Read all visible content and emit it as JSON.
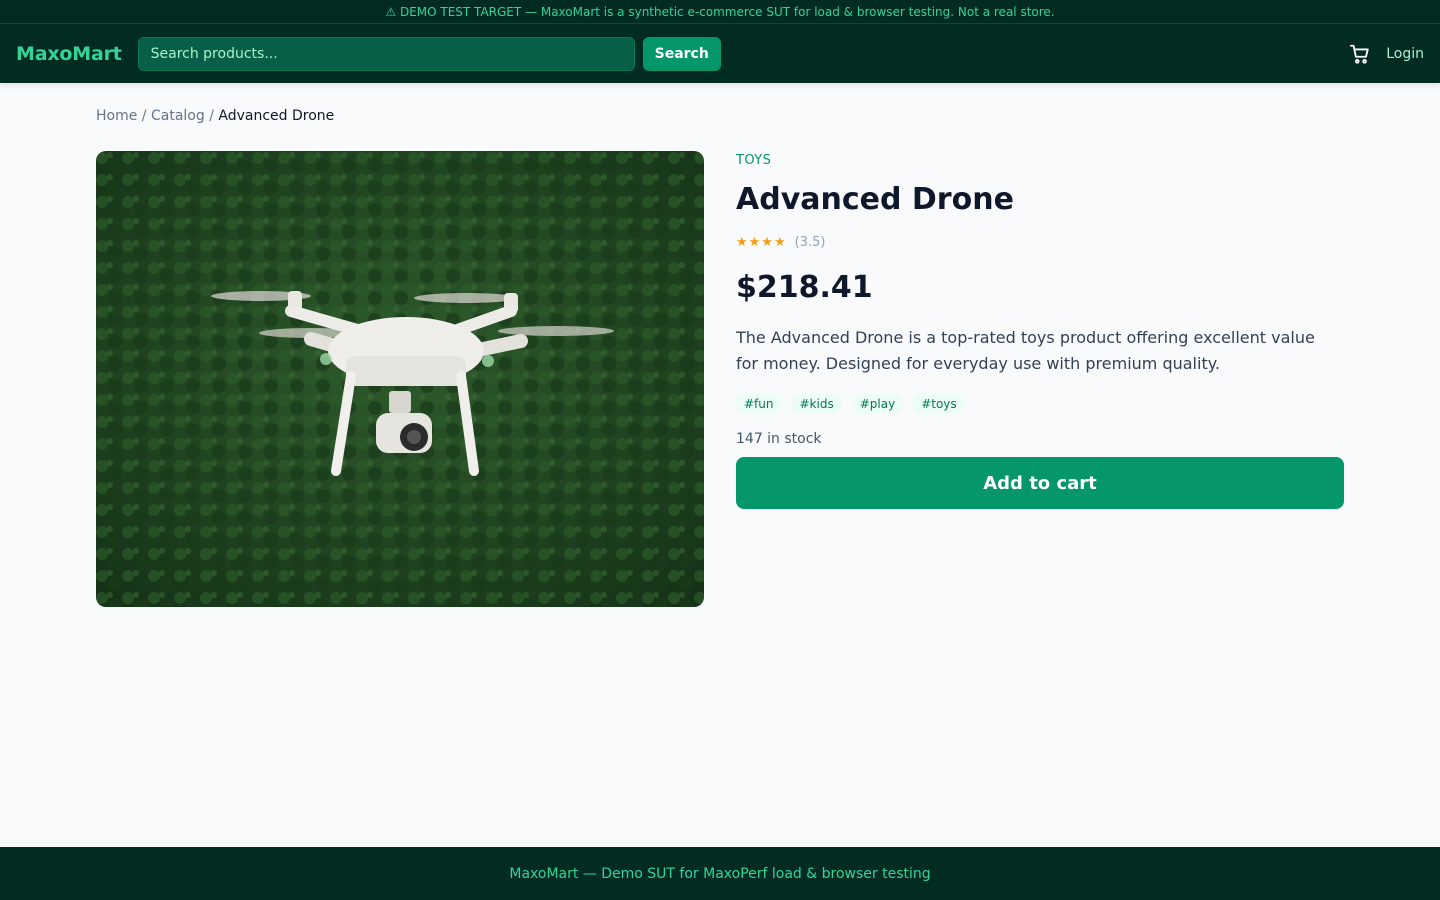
{
  "banner": {
    "text": "⚠ DEMO TEST TARGET — MaxoMart is a synthetic e-commerce SUT for load & browser testing. Not a real store."
  },
  "header": {
    "logo": "MaxoMart",
    "search_placeholder": "Search products...",
    "search_button": "Search",
    "cart_icon": "cart-icon",
    "login": "Login"
  },
  "breadcrumb": {
    "home": "Home",
    "sep": "/",
    "catalog": "Catalog",
    "current": "Advanced Drone"
  },
  "product": {
    "category": "TOYS",
    "title": "Advanced Drone",
    "stars": "★★★★",
    "rating": "(3.5)",
    "price": "$218.41",
    "description": "The Advanced Drone is a top-rated toys product offering excellent value for money. Designed for everyday use with premium quality.",
    "tags": [
      "#fun",
      "#kids",
      "#play",
      "#toys"
    ],
    "stock": "147 in stock",
    "add_to_cart": "Add to cart"
  },
  "footer": {
    "text": "MaxoMart — Demo SUT for MaxoPerf load & browser testing"
  },
  "colors": {
    "dark": "#022c22",
    "accent": "#059669",
    "brand": "#34d399"
  }
}
